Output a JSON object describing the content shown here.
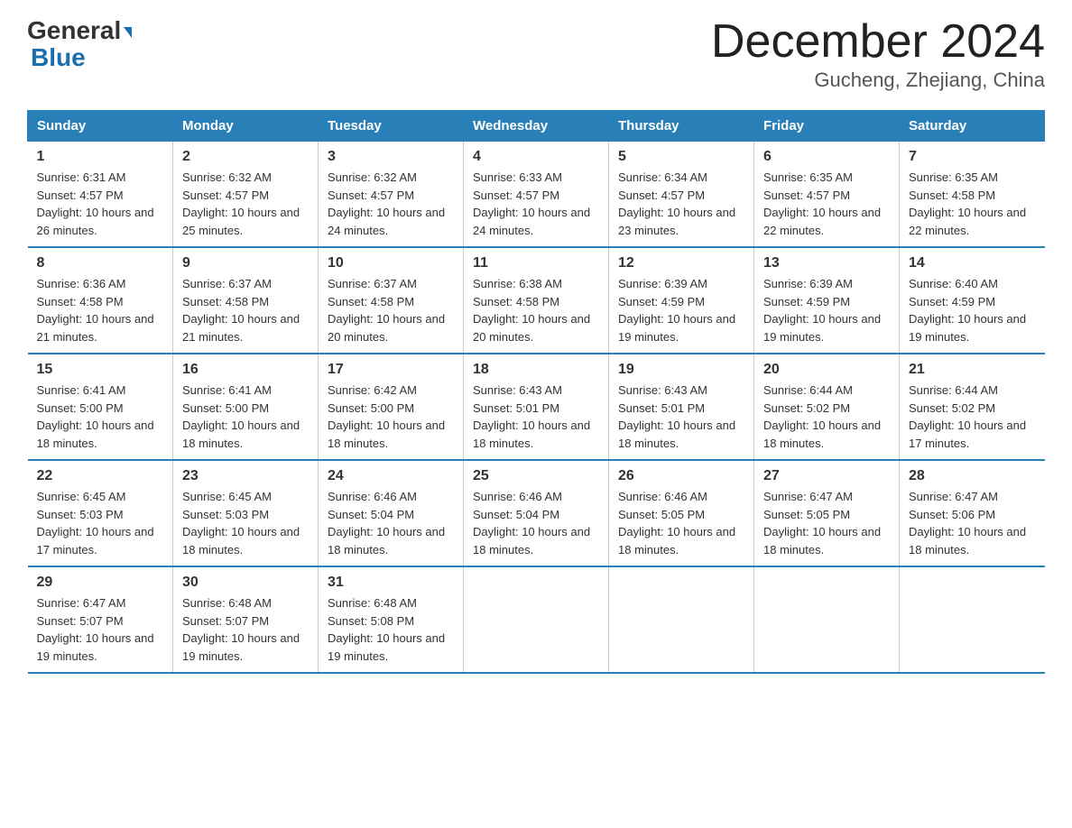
{
  "header": {
    "logo_line1": "General",
    "logo_line2": "Blue",
    "month_title": "December 2024",
    "location": "Gucheng, Zhejiang, China"
  },
  "weekdays": [
    "Sunday",
    "Monday",
    "Tuesday",
    "Wednesday",
    "Thursday",
    "Friday",
    "Saturday"
  ],
  "weeks": [
    [
      {
        "day": "1",
        "sunrise": "6:31 AM",
        "sunset": "4:57 PM",
        "daylight": "10 hours and 26 minutes."
      },
      {
        "day": "2",
        "sunrise": "6:32 AM",
        "sunset": "4:57 PM",
        "daylight": "10 hours and 25 minutes."
      },
      {
        "day": "3",
        "sunrise": "6:32 AM",
        "sunset": "4:57 PM",
        "daylight": "10 hours and 24 minutes."
      },
      {
        "day": "4",
        "sunrise": "6:33 AM",
        "sunset": "4:57 PM",
        "daylight": "10 hours and 24 minutes."
      },
      {
        "day": "5",
        "sunrise": "6:34 AM",
        "sunset": "4:57 PM",
        "daylight": "10 hours and 23 minutes."
      },
      {
        "day": "6",
        "sunrise": "6:35 AM",
        "sunset": "4:57 PM",
        "daylight": "10 hours and 22 minutes."
      },
      {
        "day": "7",
        "sunrise": "6:35 AM",
        "sunset": "4:58 PM",
        "daylight": "10 hours and 22 minutes."
      }
    ],
    [
      {
        "day": "8",
        "sunrise": "6:36 AM",
        "sunset": "4:58 PM",
        "daylight": "10 hours and 21 minutes."
      },
      {
        "day": "9",
        "sunrise": "6:37 AM",
        "sunset": "4:58 PM",
        "daylight": "10 hours and 21 minutes."
      },
      {
        "day": "10",
        "sunrise": "6:37 AM",
        "sunset": "4:58 PM",
        "daylight": "10 hours and 20 minutes."
      },
      {
        "day": "11",
        "sunrise": "6:38 AM",
        "sunset": "4:58 PM",
        "daylight": "10 hours and 20 minutes."
      },
      {
        "day": "12",
        "sunrise": "6:39 AM",
        "sunset": "4:59 PM",
        "daylight": "10 hours and 19 minutes."
      },
      {
        "day": "13",
        "sunrise": "6:39 AM",
        "sunset": "4:59 PM",
        "daylight": "10 hours and 19 minutes."
      },
      {
        "day": "14",
        "sunrise": "6:40 AM",
        "sunset": "4:59 PM",
        "daylight": "10 hours and 19 minutes."
      }
    ],
    [
      {
        "day": "15",
        "sunrise": "6:41 AM",
        "sunset": "5:00 PM",
        "daylight": "10 hours and 18 minutes."
      },
      {
        "day": "16",
        "sunrise": "6:41 AM",
        "sunset": "5:00 PM",
        "daylight": "10 hours and 18 minutes."
      },
      {
        "day": "17",
        "sunrise": "6:42 AM",
        "sunset": "5:00 PM",
        "daylight": "10 hours and 18 minutes."
      },
      {
        "day": "18",
        "sunrise": "6:43 AM",
        "sunset": "5:01 PM",
        "daylight": "10 hours and 18 minutes."
      },
      {
        "day": "19",
        "sunrise": "6:43 AM",
        "sunset": "5:01 PM",
        "daylight": "10 hours and 18 minutes."
      },
      {
        "day": "20",
        "sunrise": "6:44 AM",
        "sunset": "5:02 PM",
        "daylight": "10 hours and 18 minutes."
      },
      {
        "day": "21",
        "sunrise": "6:44 AM",
        "sunset": "5:02 PM",
        "daylight": "10 hours and 17 minutes."
      }
    ],
    [
      {
        "day": "22",
        "sunrise": "6:45 AM",
        "sunset": "5:03 PM",
        "daylight": "10 hours and 17 minutes."
      },
      {
        "day": "23",
        "sunrise": "6:45 AM",
        "sunset": "5:03 PM",
        "daylight": "10 hours and 18 minutes."
      },
      {
        "day": "24",
        "sunrise": "6:46 AM",
        "sunset": "5:04 PM",
        "daylight": "10 hours and 18 minutes."
      },
      {
        "day": "25",
        "sunrise": "6:46 AM",
        "sunset": "5:04 PM",
        "daylight": "10 hours and 18 minutes."
      },
      {
        "day": "26",
        "sunrise": "6:46 AM",
        "sunset": "5:05 PM",
        "daylight": "10 hours and 18 minutes."
      },
      {
        "day": "27",
        "sunrise": "6:47 AM",
        "sunset": "5:05 PM",
        "daylight": "10 hours and 18 minutes."
      },
      {
        "day": "28",
        "sunrise": "6:47 AM",
        "sunset": "5:06 PM",
        "daylight": "10 hours and 18 minutes."
      }
    ],
    [
      {
        "day": "29",
        "sunrise": "6:47 AM",
        "sunset": "5:07 PM",
        "daylight": "10 hours and 19 minutes."
      },
      {
        "day": "30",
        "sunrise": "6:48 AM",
        "sunset": "5:07 PM",
        "daylight": "10 hours and 19 minutes."
      },
      {
        "day": "31",
        "sunrise": "6:48 AM",
        "sunset": "5:08 PM",
        "daylight": "10 hours and 19 minutes."
      },
      {
        "day": "",
        "sunrise": "",
        "sunset": "",
        "daylight": ""
      },
      {
        "day": "",
        "sunrise": "",
        "sunset": "",
        "daylight": ""
      },
      {
        "day": "",
        "sunrise": "",
        "sunset": "",
        "daylight": ""
      },
      {
        "day": "",
        "sunrise": "",
        "sunset": "",
        "daylight": ""
      }
    ]
  ]
}
